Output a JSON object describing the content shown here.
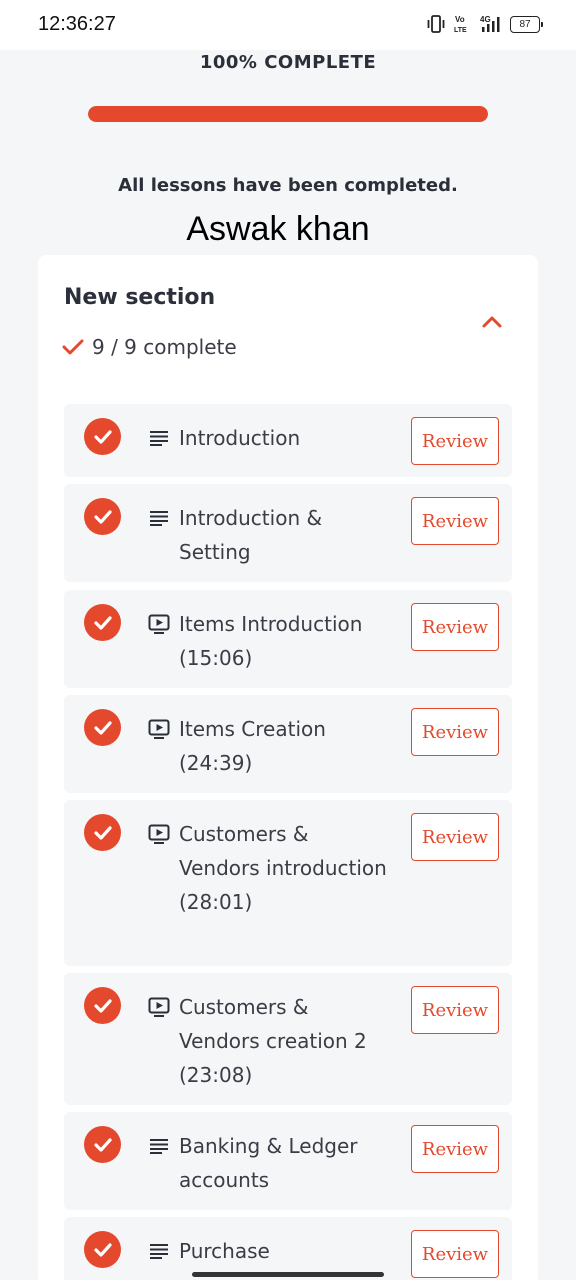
{
  "status_bar": {
    "time": "12:36:27",
    "battery": "87",
    "network": "4G",
    "volte_top": "Vo",
    "volte_bottom": "LTE"
  },
  "course": {
    "progress_label": "100% COMPLETE",
    "progress_fraction": 1.0,
    "completed_message": "All lessons have been completed.",
    "user_name": "Aswak khan"
  },
  "section": {
    "title": "New section",
    "progress_text": "9 / 9 complete",
    "lessons": [
      {
        "title": "Introduction",
        "type": "text-lines-icon",
        "review_label": "Review",
        "completed": true
      },
      {
        "title": "Introduction & Setting",
        "type": "text-lines-icon",
        "review_label": "Review",
        "completed": true
      },
      {
        "title": "Items Introduction (15:06)",
        "type": "video-icon",
        "review_label": "Review",
        "completed": true
      },
      {
        "title": "Items Creation (24:39)",
        "type": "video-icon",
        "review_label": "Review",
        "completed": true
      },
      {
        "title": "Customers & Vendors introduction (28:01)",
        "type": "video-icon",
        "review_label": "Review",
        "completed": true
      },
      {
        "title": "Customers & Vendors creation 2 (23:08)",
        "type": "video-icon",
        "review_label": "Review",
        "completed": true
      },
      {
        "title": "Banking & Ledger accounts",
        "type": "text-lines-icon",
        "review_label": "Review",
        "completed": true
      },
      {
        "title": "Purchase",
        "type": "text-lines-icon",
        "review_label": "Review",
        "completed": true
      }
    ]
  },
  "colors": {
    "accent": "#e5492d",
    "background": "#f5f6f8",
    "text": "#2b2f3a"
  }
}
